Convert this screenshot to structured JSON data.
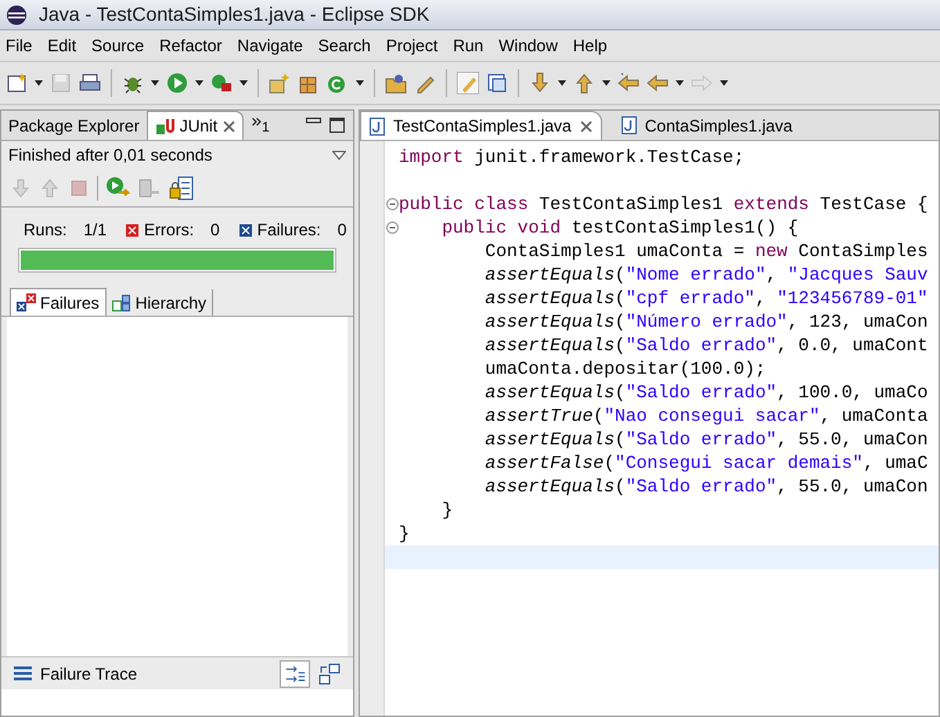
{
  "window": {
    "title": "Java - TestContaSimples1.java - Eclipse SDK"
  },
  "menu": [
    "File",
    "Edit",
    "Source",
    "Refactor",
    "Navigate",
    "Search",
    "Project",
    "Run",
    "Window",
    "Help"
  ],
  "left_panel": {
    "tabs": [
      {
        "label": "Package Explorer",
        "selected": false
      },
      {
        "label": "JUnit",
        "selected": true
      }
    ],
    "overflow": "1",
    "status": "Finished after 0,01 seconds",
    "counters": [
      {
        "kind": "runs",
        "label": "Runs:",
        "value": "1/1"
      },
      {
        "kind": "errors",
        "label": "Errors:",
        "value": "0"
      },
      {
        "kind": "failures",
        "label": "Failures:",
        "value": "0"
      }
    ],
    "progress": {
      "level": 1
    },
    "result_tabs": [
      {
        "label": "Failures",
        "selected": true
      },
      {
        "label": "Hierarchy",
        "selected": false
      }
    ],
    "failure_trace": {
      "title": "Failure Trace"
    }
  },
  "editor": {
    "tabs": [
      {
        "label": "TestContaSimples1.java",
        "selected": true
      },
      {
        "label": "ContaSimples1.java",
        "selected": false
      }
    ],
    "lines": [
      {
        "kind": "code",
        "segments": [
          {
            "kind": "keyword",
            "text": "import"
          },
          {
            "kind": "plain",
            "text": " junit.framework.TestCase;"
          }
        ]
      },
      {
        "kind": "blank"
      },
      {
        "kind": "code",
        "foldable": true,
        "segments": [
          {
            "kind": "keyword",
            "text": "public class"
          },
          {
            "kind": "plain",
            "text": " TestContaSimples1 "
          },
          {
            "kind": "keyword",
            "text": "extends"
          },
          {
            "kind": "plain",
            "text": " TestCase {"
          }
        ],
        "children": [
          {
            "kind": "code",
            "foldable": true,
            "segments": [
              {
                "kind": "keyword",
                "text": "public void"
              },
              {
                "kind": "plain",
                "text": " testContaSimples1() {"
              }
            ],
            "children": [
              {
                "kind": "code",
                "segments": [
                  {
                    "kind": "plain",
                    "text": "ContaSimples1 umaConta = "
                  },
                  {
                    "kind": "keyword",
                    "text": "new"
                  },
                  {
                    "kind": "plain",
                    "text": " ContaSimples"
                  }
                ]
              },
              {
                "kind": "code",
                "segments": [
                  {
                    "kind": "method",
                    "text": "assertEquals"
                  },
                  {
                    "kind": "plain",
                    "text": "("
                  },
                  {
                    "kind": "string",
                    "text": "\"Nome errado\""
                  },
                  {
                    "kind": "plain",
                    "text": ", "
                  },
                  {
                    "kind": "string",
                    "text": "\"Jacques Sauv"
                  }
                ]
              },
              {
                "kind": "code",
                "segments": [
                  {
                    "kind": "method",
                    "text": "assertEquals"
                  },
                  {
                    "kind": "plain",
                    "text": "("
                  },
                  {
                    "kind": "string",
                    "text": "\"cpf errado\""
                  },
                  {
                    "kind": "plain",
                    "text": ", "
                  },
                  {
                    "kind": "string",
                    "text": "\"123456789-01\""
                  }
                ]
              },
              {
                "kind": "code",
                "segments": [
                  {
                    "kind": "method",
                    "text": "assertEquals"
                  },
                  {
                    "kind": "plain",
                    "text": "("
                  },
                  {
                    "kind": "string",
                    "text": "\"Número errado\""
                  },
                  {
                    "kind": "plain",
                    "text": ", 123, umaCon"
                  }
                ]
              },
              {
                "kind": "code",
                "segments": [
                  {
                    "kind": "method",
                    "text": "assertEquals"
                  },
                  {
                    "kind": "plain",
                    "text": "("
                  },
                  {
                    "kind": "string",
                    "text": "\"Saldo errado\""
                  },
                  {
                    "kind": "plain",
                    "text": ", 0.0, umaCont"
                  }
                ]
              },
              {
                "kind": "code",
                "segments": [
                  {
                    "kind": "plain",
                    "text": "umaConta.depositar(100.0);"
                  }
                ]
              },
              {
                "kind": "code",
                "segments": [
                  {
                    "kind": "method",
                    "text": "assertEquals"
                  },
                  {
                    "kind": "plain",
                    "text": "("
                  },
                  {
                    "kind": "string",
                    "text": "\"Saldo errado\""
                  },
                  {
                    "kind": "plain",
                    "text": ", 100.0, umaCo"
                  }
                ]
              },
              {
                "kind": "code",
                "segments": [
                  {
                    "kind": "method",
                    "text": "assertTrue"
                  },
                  {
                    "kind": "plain",
                    "text": "("
                  },
                  {
                    "kind": "string",
                    "text": "\"Nao consegui sacar\""
                  },
                  {
                    "kind": "plain",
                    "text": ", umaConta"
                  }
                ]
              },
              {
                "kind": "code",
                "segments": [
                  {
                    "kind": "method",
                    "text": "assertEquals"
                  },
                  {
                    "kind": "plain",
                    "text": "("
                  },
                  {
                    "kind": "string",
                    "text": "\"Saldo errado\""
                  },
                  {
                    "kind": "plain",
                    "text": ", 55.0, umaCon"
                  }
                ]
              },
              {
                "kind": "code",
                "segments": [
                  {
                    "kind": "method",
                    "text": "assertFalse"
                  },
                  {
                    "kind": "plain",
                    "text": "("
                  },
                  {
                    "kind": "string",
                    "text": "\"Consegui sacar demais\""
                  },
                  {
                    "kind": "plain",
                    "text": ", umaC"
                  }
                ]
              },
              {
                "kind": "code",
                "segments": [
                  {
                    "kind": "method",
                    "text": "assertEquals"
                  },
                  {
                    "kind": "plain",
                    "text": "("
                  },
                  {
                    "kind": "string",
                    "text": "\"Saldo errado\""
                  },
                  {
                    "kind": "plain",
                    "text": ", 55.0, umaCon"
                  }
                ]
              }
            ]
          },
          {
            "kind": "code",
            "segments": [
              {
                "kind": "plain",
                "text": "}"
              }
            ]
          }
        ]
      },
      {
        "kind": "code",
        "segments": [
          {
            "kind": "plain",
            "text": "}"
          }
        ]
      },
      {
        "kind": "blank",
        "current": true
      }
    ]
  }
}
